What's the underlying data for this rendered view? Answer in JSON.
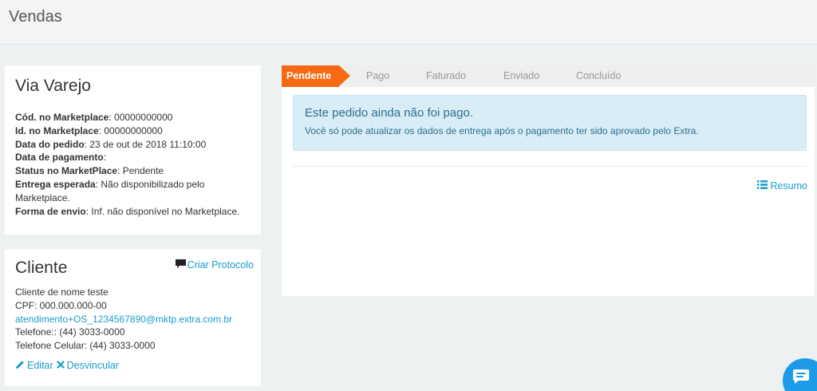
{
  "header": {
    "title": "Vendas"
  },
  "marketplace": {
    "title": "Via Varejo",
    "fields": [
      {
        "label": "Cód. no Marketplace",
        "value": ": 00000000000"
      },
      {
        "label": "Id. no Marketplace",
        "value": ": 00000000000"
      },
      {
        "label": "Data do pedido",
        "value": ": 23 de out de 2018 11:10:00"
      },
      {
        "label": "Data de pagamento",
        "value": ":"
      },
      {
        "label": "Status no MarketPlace",
        "value": ": Pendente"
      },
      {
        "label": "Entrega esperada",
        "value": ": Não disponibilizado pelo Marketplace."
      },
      {
        "label": "Forma de envio",
        "value": ": Inf. não disponível no Marketplace."
      }
    ]
  },
  "client": {
    "title": "Cliente",
    "protocol_link": "Criar Protocolo",
    "name": "Cliente de nome teste",
    "cpf": "CPF: 000.000.000-00",
    "email": "atendimento+OS_1234567890@mktp.extra.com.br",
    "phone": "Telefone:: (44) 3033-0000",
    "mobile": "Telefone Celular: (44) 3033-0000",
    "edit_label": "Editar",
    "unlink_label": "Desvincular"
  },
  "steps": [
    "Pendente",
    "Pago",
    "Faturado",
    "Enviado",
    "Concluído"
  ],
  "alert": {
    "title": "Este pedido ainda não foi pago.",
    "text": "Você só pode atualizar os dados de entrega após o pagamento ter sido aprovado pelo Extra."
  },
  "resumo_label": "Resumo",
  "colors": {
    "accent": "#f56a12",
    "link": "#1a9bcb",
    "chat": "#1e9be6",
    "alert_bg": "#d9edf6"
  }
}
